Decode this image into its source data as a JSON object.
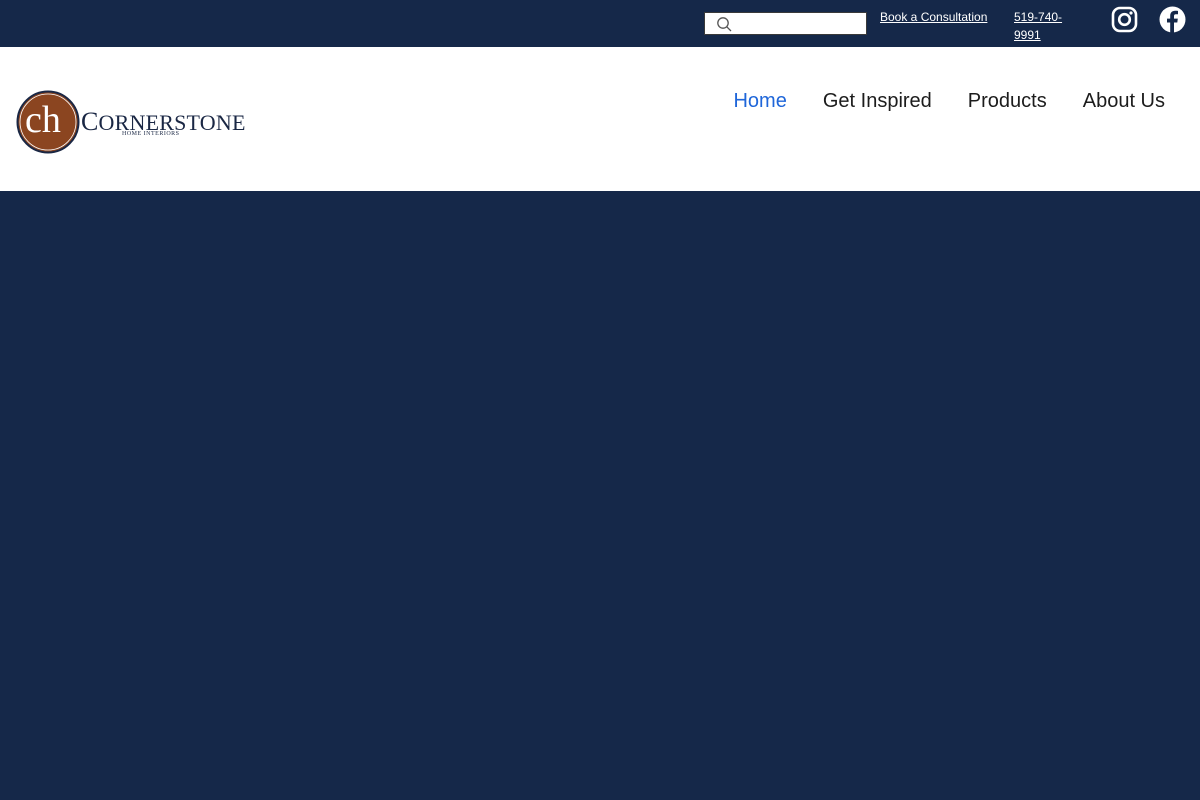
{
  "topbar": {
    "search": {
      "value": "",
      "placeholder": ""
    },
    "book_label": "Book a Consultation",
    "phone_label": "519-740-9991"
  },
  "brand": {
    "monogram": "ch",
    "name_first": "C",
    "name_rest": "ORNERSTONE",
    "tagline": "HOME INTERIORS"
  },
  "nav": {
    "items": [
      {
        "label": "Home",
        "active": true
      },
      {
        "label": "Get Inspired",
        "active": false
      },
      {
        "label": "Products",
        "active": false
      },
      {
        "label": "About Us",
        "active": false
      }
    ]
  },
  "icons": {
    "search": "search-icon",
    "instagram": "instagram-icon",
    "facebook": "facebook-icon"
  },
  "colors": {
    "navy": "#152849",
    "accent_blue": "#1f66d9",
    "logo_brown": "#8b4520"
  }
}
